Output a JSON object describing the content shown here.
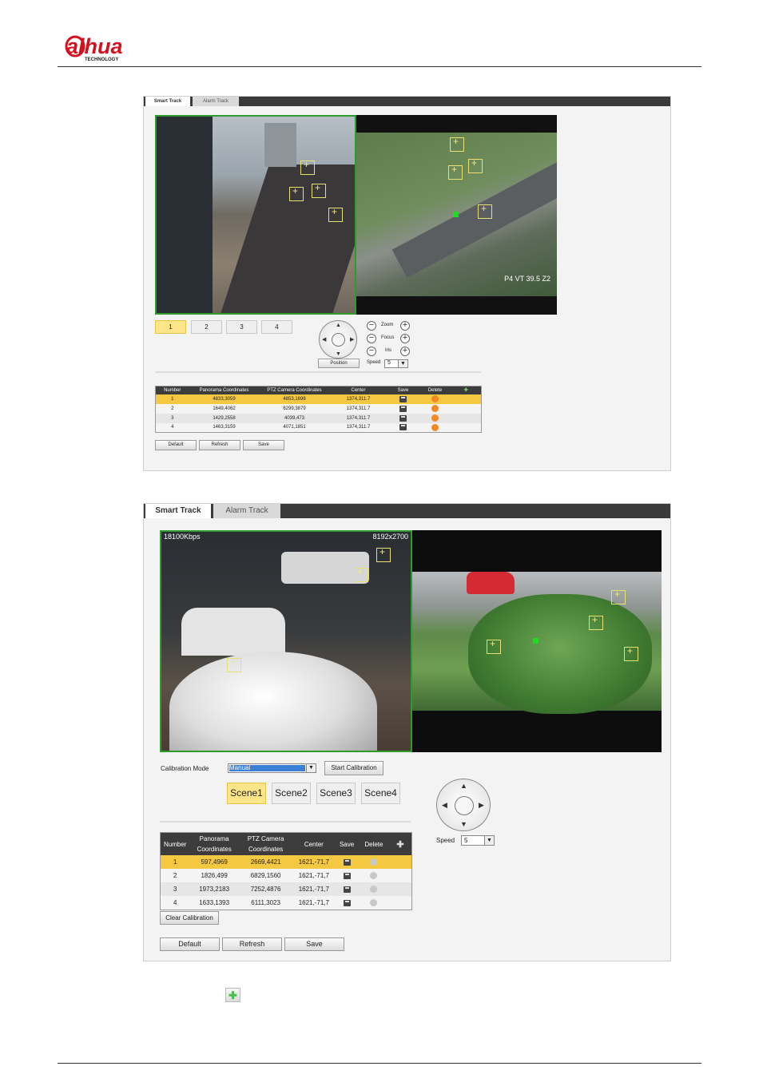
{
  "brand": {
    "logo_main": "alhua",
    "logo_sub": "TECHNOLOGY"
  },
  "figure1": {
    "tabs": [
      "Smart Track",
      "Alarm Track"
    ],
    "scene_buttons": [
      "1",
      "2",
      "3",
      "4"
    ],
    "ptz_labels": {
      "zoom": "Zoom",
      "focus": "Focus",
      "iris": "Iris",
      "position": "Position",
      "speed": "Speed",
      "speed_value": "5"
    },
    "overlay_text": "P4 VT 39.5 Z2",
    "table_headers": [
      "Number",
      "Panorama Coordinates",
      "PTZ Camera Coordinates",
      "Center",
      "Save",
      "Delete"
    ],
    "rows": [
      [
        "1",
        "4833,3059",
        "4853,1698",
        "1374,311.7"
      ],
      [
        "2",
        "1649,4062",
        "6299,3879",
        "1374,311.7"
      ],
      [
        "3",
        "1429,2558",
        "4039,473",
        "1374,311.7"
      ],
      [
        "4",
        "1463,3159",
        "4071,1851",
        "1374,311.7"
      ]
    ],
    "buttons": [
      "Default",
      "Refresh",
      "Save"
    ]
  },
  "figure2": {
    "tabs": [
      "Smart Track",
      "Alarm Track"
    ],
    "bitrate": "18100Kbps",
    "resolution": "8192x2700",
    "calibration_mode_label": "Calibration Mode",
    "calibration_mode_value": "Manual",
    "start_calibration": "Start Calibration",
    "scene_buttons": [
      "Scene1",
      "Scene2",
      "Scene3",
      "Scene4"
    ],
    "speed_label": "Speed",
    "speed_value": "5",
    "table_headers": [
      "Number",
      "Panorama\nCoordinates",
      "PTZ Camera\nCoordinates",
      "Center",
      "Save",
      "Delete"
    ],
    "rows": [
      [
        "1",
        "597,4969",
        "2669,4421",
        "1621,-71,7"
      ],
      [
        "2",
        "1826,499",
        "6829,1560",
        "1621,-71,7"
      ],
      [
        "3",
        "1973,2183",
        "7252,4876",
        "1621,-71,7"
      ],
      [
        "4",
        "1633,1393",
        "6111,3023",
        "1621,-71,7"
      ]
    ],
    "clear_calibration": "Clear Calibration",
    "buttons": [
      "Default",
      "Refresh",
      "Save"
    ]
  },
  "colors": {
    "selected_row": "#f5c842",
    "accent_green": "#19e01c",
    "delete_orange": "#f08a24"
  },
  "icons": {
    "add_icon": "green-plus-icon"
  }
}
